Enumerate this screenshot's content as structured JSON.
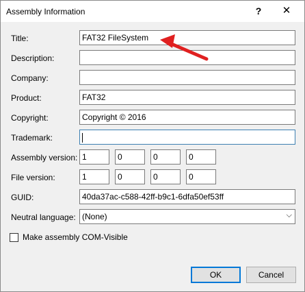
{
  "window": {
    "title": "Assembly Information",
    "help_label": "?",
    "close_label": "✕"
  },
  "fields": {
    "title": {
      "label": "Title:",
      "value": "FAT32 FileSystem"
    },
    "description": {
      "label": "Description:",
      "value": ""
    },
    "company": {
      "label": "Company:",
      "value": ""
    },
    "product": {
      "label": "Product:",
      "value": "FAT32"
    },
    "copyright": {
      "label": "Copyright:",
      "value": "Copyright ©  2016"
    },
    "trademark": {
      "label": "Trademark:",
      "value": ""
    },
    "assembly_version": {
      "label": "Assembly version:",
      "values": [
        "1",
        "0",
        "0",
        "0"
      ]
    },
    "file_version": {
      "label": "File version:",
      "values": [
        "1",
        "0",
        "0",
        "0"
      ]
    },
    "guid": {
      "label": "GUID:",
      "value": "40da37ac-c588-42ff-b9c1-6dfa50ef53ff"
    },
    "neutral_language": {
      "label": "Neutral language:",
      "value": "(None)"
    }
  },
  "com_visible": {
    "label": "Make assembly COM-Visible",
    "checked": false
  },
  "buttons": {
    "ok": "OK",
    "cancel": "Cancel"
  },
  "colors": {
    "accent": "#0078d7",
    "annotation_arrow": "#e02020"
  }
}
